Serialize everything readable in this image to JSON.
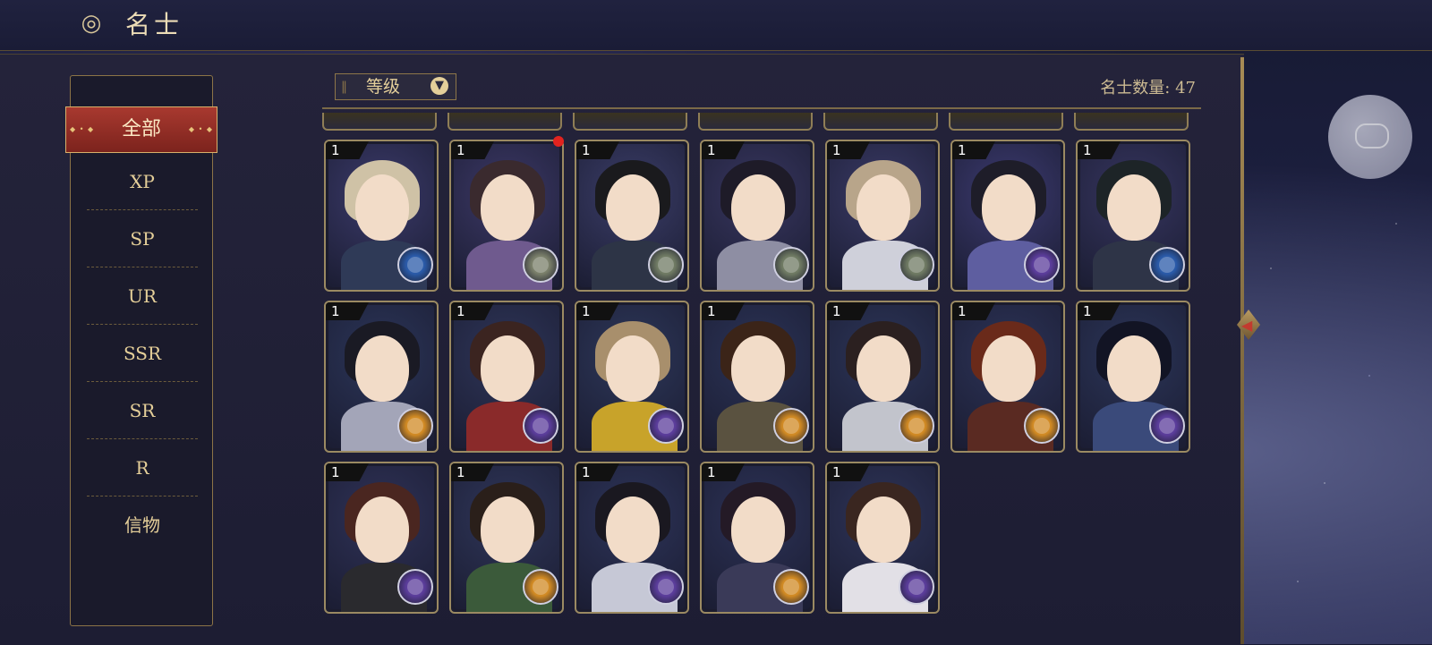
{
  "header": {
    "emblem": "◎",
    "title": "名士"
  },
  "sidebar": {
    "active": "全部",
    "items": [
      "XP",
      "SP",
      "UR",
      "SSR",
      "SR",
      "R",
      "信物"
    ]
  },
  "toolbar": {
    "sort_label": "等级",
    "count_text": "名士数量: 47"
  },
  "cards": [
    {
      "level": "1",
      "hair": "#cfc2a6",
      "robe": "#2f3a57",
      "badge": "#2a5aa8",
      "bg": "#3b3a6a"
    },
    {
      "level": "1",
      "hair": "#3a2a2e",
      "robe": "#6f5a8e",
      "badge": "#7a7f6a",
      "bg": "#3c3866"
    },
    {
      "level": "1",
      "hair": "#1a1a1d",
      "robe": "#2d3446",
      "badge": "#6f7a63",
      "bg": "#3b3d68"
    },
    {
      "level": "1",
      "hair": "#1e1b28",
      "robe": "#8e8ea3",
      "badge": "#6f7a63",
      "bg": "#38365f"
    },
    {
      "level": "1",
      "hair": "#b8a58a",
      "robe": "#cfd0da",
      "badge": "#6f7a63",
      "bg": "#3a3a66"
    },
    {
      "level": "1",
      "hair": "#1e1d29",
      "robe": "#5e5ea0",
      "badge": "#5b3d9b",
      "bg": "#3c3a70"
    },
    {
      "level": "1",
      "hair": "#1d2427",
      "robe": "#2e3447",
      "badge": "#2a5aa8",
      "bg": "#36355f"
    },
    {
      "level": "1",
      "hair": "#1a1a24",
      "robe": "#a3a5b8",
      "badge": "#d18a24",
      "bg": "#2b3558"
    },
    {
      "level": "1",
      "hair": "#3b2420",
      "robe": "#8a2a2a",
      "badge": "#5b3d9b",
      "bg": "#2e3558"
    },
    {
      "level": "1",
      "hair": "#a88f6c",
      "robe": "#c8a32a",
      "badge": "#5b3d9b",
      "bg": "#2d3759"
    },
    {
      "level": "1",
      "hair": "#3b2418",
      "robe": "#5a5240",
      "badge": "#d18a24",
      "bg": "#2b3356"
    },
    {
      "level": "1",
      "hair": "#2b2020",
      "robe": "#c2c4cc",
      "badge": "#d18a24",
      "bg": "#2c3558"
    },
    {
      "level": "1",
      "hair": "#6a2a1a",
      "robe": "#5a2a22",
      "badge": "#d18a24",
      "bg": "#2c3357"
    },
    {
      "level": "1",
      "hair": "#121424",
      "robe": "#3a4a7a",
      "badge": "#5b3d9b",
      "bg": "#2b3558"
    },
    {
      "level": "1",
      "hair": "#4a2620",
      "robe": "#2a2a2e",
      "badge": "#5b3d9b",
      "bg": "#2f3257"
    },
    {
      "level": "1",
      "hair": "#2a1f1a",
      "robe": "#3b5a3a",
      "badge": "#d18a24",
      "bg": "#2f3659"
    },
    {
      "level": "1",
      "hair": "#1a1820",
      "robe": "#c6c8d6",
      "badge": "#5b3d9b",
      "bg": "#2d3459"
    },
    {
      "level": "1",
      "hair": "#241a26",
      "robe": "#3a3a58",
      "badge": "#d18a24",
      "bg": "#2c3256"
    },
    {
      "level": "1",
      "hair": "#3a2620",
      "robe": "#e2e0e6",
      "badge": "#5b3d9b",
      "bg": "#2e3458"
    }
  ],
  "partial_top_row": 7,
  "colors": {
    "accent_red": "#a8392f",
    "gold": "#c9b07a",
    "notification": "#e2231f"
  },
  "icons": {
    "collapse": "chevron-left-icon",
    "chat": "chat-bubbles-icon",
    "sort": "chevron-down-icon",
    "element_badge": "element-badge-icon"
  }
}
